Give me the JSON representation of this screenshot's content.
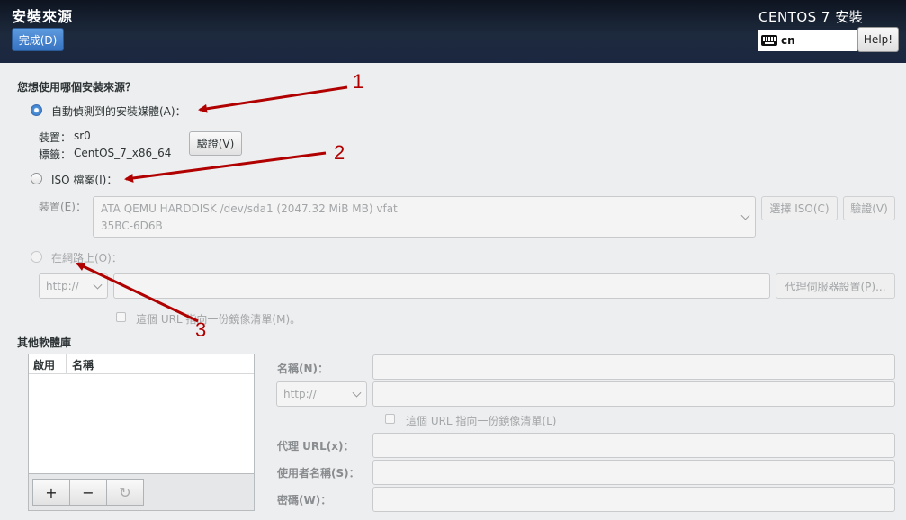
{
  "header": {
    "spoke_title": "安裝來源",
    "done_label": "完成(D)",
    "product_title": "CENTOS 7 安裝",
    "keyboard_layout": "cn",
    "help_label": "Help!"
  },
  "source": {
    "heading": "您想使用哪個安裝來源？",
    "auto_detect_label": "自動偵測到的安裝媒體(A)：",
    "device_label": "裝置：",
    "device_value": "sr0",
    "tag_label": "標籤：",
    "tag_value": "CentOS_7_x86_64",
    "verify_label": "驗證(V)",
    "iso_label": "ISO 檔案(I)：",
    "iso_device_label": "裝置(E)：",
    "iso_device_line1": "ATA QEMU HARDDISK /dev/sda1 (2047.32 MiB MB) vfat",
    "iso_device_line2": "35BC-6D6B",
    "choose_iso_label": "選擇 ISO(C)",
    "iso_verify_label": "驗證(V)",
    "network_label": "在網路上(O)：",
    "protocol_value": "http://",
    "proxy_label": "代理伺服器設置(P)...",
    "mirror_list_label": "這個 URL 指向一份鏡像清單(M)。"
  },
  "repos": {
    "heading": "其他軟體庫",
    "col_enabled": "啟用",
    "col_name": "名稱",
    "add_label": "+",
    "remove_label": "−",
    "reset_label": "↻",
    "name_label": "名稱(N)：",
    "protocol_value": "http://",
    "mirror_list_label": "這個 URL 指向一份鏡像清單(L)",
    "proxy_url_label": "代理 URL(x)：",
    "username_label": "使用者名稱(S)：",
    "password_label": "密碼(W)："
  },
  "annotations": {
    "n1": "1",
    "n2": "2",
    "n3": "3",
    "arrow_color": "#b00000"
  }
}
